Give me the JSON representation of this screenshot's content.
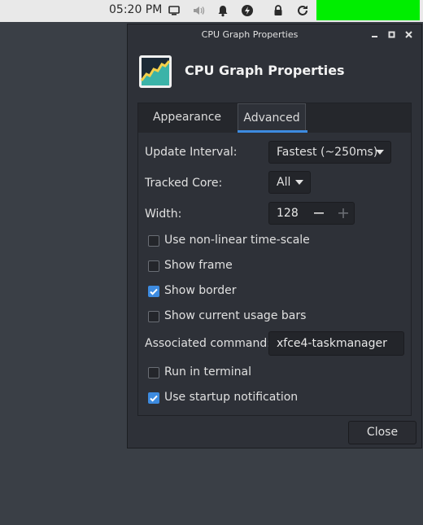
{
  "panel": {
    "clock": "05:20 PM",
    "icons": [
      "display-icon",
      "volume-icon",
      "bell-icon",
      "power-manager-icon",
      "lock-icon",
      "refresh-icon"
    ],
    "accent_block_color": "#00ee00"
  },
  "dialog": {
    "window_title": "CPU Graph Properties",
    "header_title": "CPU Graph Properties",
    "window_buttons": [
      "minimize-icon",
      "maximize-icon",
      "close-icon"
    ],
    "tabs": [
      {
        "label": "Appearance",
        "active": false
      },
      {
        "label": "Advanced",
        "active": true
      }
    ],
    "update_interval": {
      "label": "Update Interval:",
      "value": "Fastest (~250ms)"
    },
    "tracked_core": {
      "label": "Tracked Core:",
      "value": "All"
    },
    "width": {
      "label": "Width:",
      "value": "128"
    },
    "checkboxes": [
      {
        "label": "Use non-linear time-scale",
        "checked": false
      },
      {
        "label": "Show frame",
        "checked": false
      },
      {
        "label": "Show border",
        "checked": true
      },
      {
        "label": "Show current usage bars",
        "checked": false
      }
    ],
    "associated_command": {
      "label": "Associated command:",
      "value": "xfce4-taskmanager"
    },
    "checkboxes_bottom": [
      {
        "label": "Run in terminal",
        "checked": false
      },
      {
        "label": "Use startup notification",
        "checked": true
      }
    ],
    "close_label": "Close",
    "accent_color": "#3d8be0"
  }
}
